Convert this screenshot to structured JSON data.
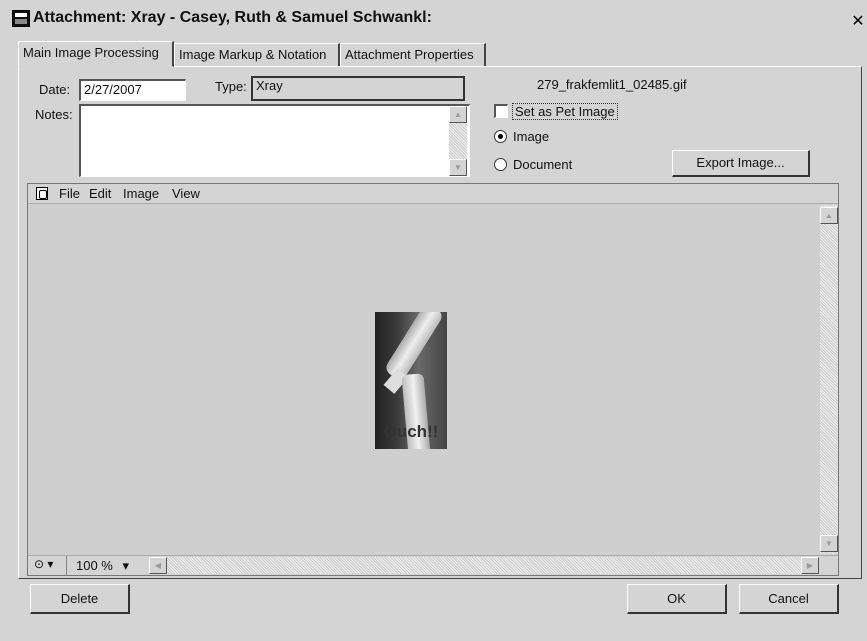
{
  "window": {
    "title": "Attachment: Xray - Casey, Ruth & Samuel Schwankl:",
    "close_glyph": "✕"
  },
  "tabs": [
    {
      "label": "Main Image Processing",
      "active": true
    },
    {
      "label": "Image Markup & Notation",
      "active": false
    },
    {
      "label": "Attachment Properties",
      "active": false
    }
  ],
  "form": {
    "date_label": "Date:",
    "date_value": "2/27/2007",
    "type_label": "Type:",
    "type_value": "Xray",
    "notes_label": "Notes:",
    "notes_value": "",
    "filename": "279_frakfemlit1_02485.gif",
    "pet_image_label": "Set as Pet Image",
    "pet_image_checked": false,
    "radio_image_label": "Image",
    "radio_document_label": "Document",
    "selected_type": "Image",
    "export_button": "Export Image..."
  },
  "viewer": {
    "menu": [
      "File",
      "Edit",
      "Image",
      "View"
    ],
    "zoom": "100 %",
    "image_caption": "Ouch!!"
  },
  "footer": {
    "delete_button": "Delete",
    "ok_button": "OK",
    "cancel_button": "Cancel"
  },
  "icons": {
    "scroll_up": "▲",
    "scroll_down": "▼",
    "scroll_left": "◀",
    "scroll_right": "▶",
    "dropdown": "▾",
    "hand_tool": "⊙"
  },
  "colors": {
    "window_bg": "#d4d4d4",
    "viewer_bg": "#cfcfcf"
  }
}
